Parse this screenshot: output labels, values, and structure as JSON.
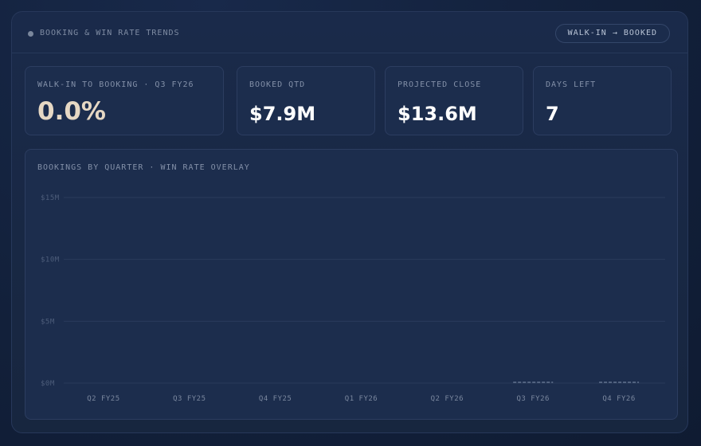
{
  "header": {
    "title": "BOOKING & WIN RATE TRENDS",
    "toggle_label": "WALK-IN → BOOKED"
  },
  "kpis": [
    {
      "label": "WALK-IN TO BOOKING · Q3 FY26",
      "value": "0.0%"
    },
    {
      "label": "BOOKED QTD",
      "value": "$7.9M"
    },
    {
      "label": "PROJECTED CLOSE",
      "value": "$13.6M"
    },
    {
      "label": "DAYS LEFT",
      "value": "7"
    }
  ],
  "chart": {
    "title": "BOOKINGS BY QUARTER · WIN RATE OVERLAY"
  },
  "colors": {
    "panel_bg": "#18284a",
    "card_bg": "#1c2d4d",
    "accent_value": "#e6d8c4",
    "gridline": "#2a3b5c",
    "muted_text": "#8390a8"
  },
  "chart_data": {
    "type": "bar",
    "categories": [
      "Q2 FY25",
      "Q3 FY25",
      "Q4 FY25",
      "Q1 FY26",
      "Q2 FY26",
      "Q3 FY26",
      "Q4 FY26"
    ],
    "series": [
      {
        "values": [
          0,
          0,
          0,
          0,
          0,
          0,
          0
        ]
      }
    ],
    "targets": [
      null,
      null,
      null,
      null,
      null,
      0,
      0
    ],
    "yticks": [
      "$0M",
      "$5M",
      "$10M",
      "$15M"
    ],
    "ytick_values": [
      0,
      5,
      10,
      15
    ],
    "ylim": [
      0,
      15
    ],
    "grid": true
  }
}
